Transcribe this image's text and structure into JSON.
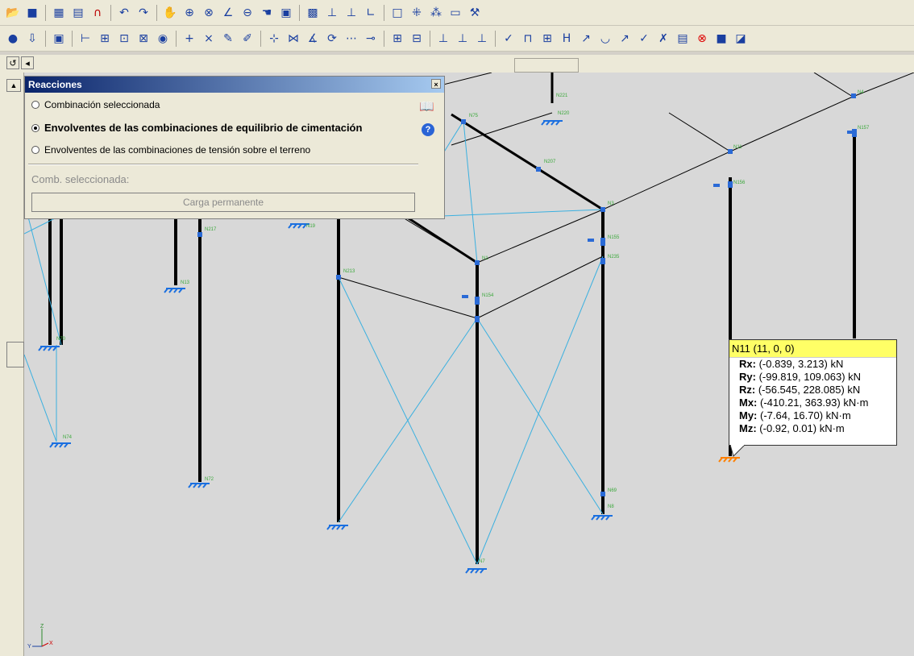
{
  "toolbar1": {
    "icons": [
      "open-folder-icon",
      "save-icon",
      "dxf-export-icon",
      "dwg-export-icon",
      "magnet-icon",
      "undo-icon",
      "redo-icon",
      "select-icon",
      "zoom-window-icon",
      "zoom-extents-icon",
      "measure-icon",
      "zoom-previous-icon",
      "pan-icon",
      "redraw-icon",
      "find-icon",
      "layers-icon",
      "node-icon",
      "axes-icon",
      "rectangle-icon",
      "grid-icon",
      "snap-icon",
      "view-icon",
      "tools-icon"
    ]
  },
  "toolbar2": {
    "icons": [
      "globe-icon",
      "import-icon",
      "results-icon",
      "bar-icon",
      "node-add-icon",
      "node-delete-icon",
      "visibility-icon",
      "restraint-icon",
      "load-icon"
    ]
  },
  "panel": {
    "title": "Reacciones",
    "close": "×",
    "options": [
      {
        "label": "Combinación seleccionada",
        "selected": false
      },
      {
        "label": "Envolventes de las combinaciones de equilibrio de cimentación",
        "selected": true
      },
      {
        "label": "Envolventes de las combinaciones de tensión sobre el terreno",
        "selected": false
      }
    ],
    "comb_label": "Comb. seleccionada:",
    "comb_button": "Carga permanente"
  },
  "tooltip": {
    "header": "N11 (11, 0, 0)",
    "rows": [
      {
        "label": "Rx:",
        "value": " (-0.839, 3.213) kN"
      },
      {
        "label": "Ry:",
        "value": " (-99.819, 109.063) kN"
      },
      {
        "label": "Rz:",
        "value": " (-56.545, 228.085) kN"
      },
      {
        "label": "Mx:",
        "value": " (-410.21, 363.93) kN·m"
      },
      {
        "label": "My:",
        "value": " (-7.64, 16.70) kN·m"
      },
      {
        "label": "Mz:",
        "value": " (-0.92, 0.01) kN·m"
      }
    ]
  },
  "node_labels": [
    "N221",
    "N220",
    "N75",
    "N207",
    "N3",
    "N155",
    "N235",
    "N1",
    "N154",
    "N213",
    "N217",
    "N19",
    "N13",
    "N74",
    "N70",
    "N72",
    "N69",
    "N8",
    "N7",
    "N156",
    "N157",
    "N11",
    "N4"
  ],
  "axes": {
    "z": "Z",
    "y": "Y",
    "x": "X"
  },
  "colors": {
    "title_bar": "#0a246a",
    "tooltip_header": "#ffff66",
    "support_blue": "#1a6fe0",
    "support_selected": "#ff8000",
    "member": "#000000",
    "brace": "#3ab0e0"
  }
}
